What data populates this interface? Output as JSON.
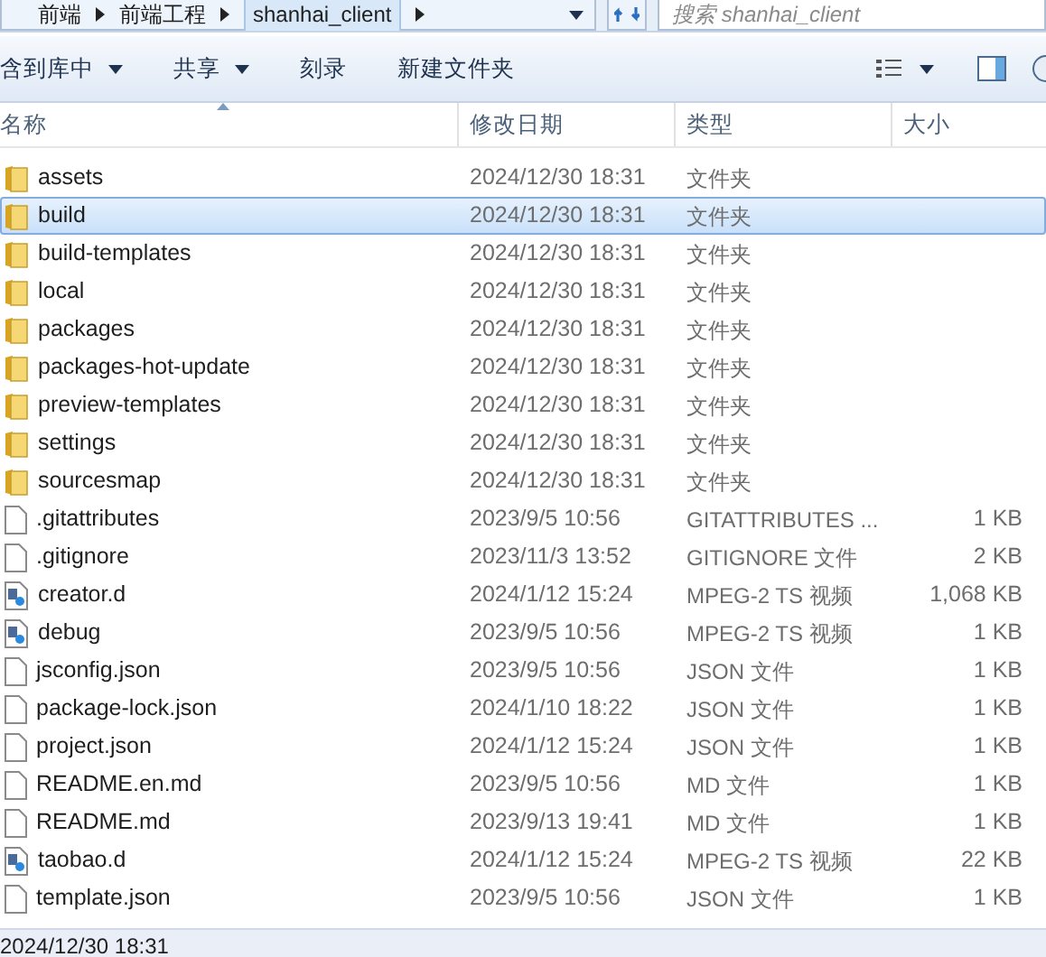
{
  "address_bar": {
    "breadcrumbs": [
      "前端",
      "前端工程",
      "shanhai_client"
    ]
  },
  "search": {
    "placeholder": "搜索 shanhai_client"
  },
  "toolbar": {
    "buttons": [
      {
        "label": "含到库中",
        "dropdown": true
      },
      {
        "label": "共享",
        "dropdown": true
      },
      {
        "label": "刻录",
        "dropdown": false
      },
      {
        "label": "新建文件夹",
        "dropdown": false
      }
    ]
  },
  "table": {
    "columns": [
      "名称",
      "修改日期",
      "类型",
      "大小"
    ],
    "rows": [
      {
        "kind": "folder",
        "name": "assets",
        "date": "2024/12/30 18:31",
        "type": "文件夹",
        "selected": false
      },
      {
        "kind": "folder",
        "name": "build",
        "date": "2024/12/30 18:31",
        "type": "文件夹",
        "selected": true
      },
      {
        "kind": "folder",
        "name": "build-templates",
        "date": "2024/12/30 18:31",
        "type": "文件夹",
        "selected": false
      },
      {
        "kind": "folder",
        "name": "local",
        "date": "2024/12/30 18:31",
        "type": "文件夹",
        "selected": false
      },
      {
        "kind": "folder",
        "name": "packages",
        "date": "2024/12/30 18:31",
        "type": "文件夹",
        "selected": false
      },
      {
        "kind": "folder",
        "name": "packages-hot-update",
        "date": "2024/12/30 18:31",
        "type": "文件夹",
        "selected": false
      },
      {
        "kind": "folder",
        "name": "preview-templates",
        "date": "2024/12/30 18:31",
        "type": "文件夹",
        "selected": false
      },
      {
        "kind": "folder",
        "name": "settings",
        "date": "2024/12/30 18:31",
        "type": "文件夹",
        "selected": false
      },
      {
        "kind": "folder",
        "name": "sourcesmap",
        "date": "2024/12/30 18:31",
        "type": "文件夹",
        "selected": false
      },
      {
        "kind": "file",
        "name": ".gitattributes",
        "date": "2023/9/5 10:56",
        "type": "GITATTRIBUTES ...",
        "size": "1 KB",
        "selected": false
      },
      {
        "kind": "file",
        "name": ".gitignore",
        "date": "2023/11/3 13:52",
        "type": "GITIGNORE 文件",
        "size": "2 KB",
        "selected": false
      },
      {
        "kind": "video",
        "name": "creator.d",
        "date": "2024/1/12 15:24",
        "type": "MPEG-2 TS 视频",
        "size": "1,068 KB",
        "selected": false
      },
      {
        "kind": "video",
        "name": "debug",
        "date": "2023/9/5 10:56",
        "type": "MPEG-2 TS 视频",
        "size": "1 KB",
        "selected": false
      },
      {
        "kind": "file",
        "name": "jsconfig.json",
        "date": "2023/9/5 10:56",
        "type": "JSON 文件",
        "size": "1 KB",
        "selected": false
      },
      {
        "kind": "file",
        "name": "package-lock.json",
        "date": "2024/1/10 18:22",
        "type": "JSON 文件",
        "size": "1 KB",
        "selected": false
      },
      {
        "kind": "file",
        "name": "project.json",
        "date": "2024/1/12 15:24",
        "type": "JSON 文件",
        "size": "1 KB",
        "selected": false
      },
      {
        "kind": "file",
        "name": "README.en.md",
        "date": "2023/9/5 10:56",
        "type": "MD 文件",
        "size": "1 KB",
        "selected": false
      },
      {
        "kind": "file",
        "name": "README.md",
        "date": "2023/9/13 19:41",
        "type": "MD 文件",
        "size": "1 KB",
        "selected": false
      },
      {
        "kind": "video",
        "name": "taobao.d",
        "date": "2024/1/12 15:24",
        "type": "MPEG-2 TS 视频",
        "size": "22 KB",
        "selected": false
      },
      {
        "kind": "file",
        "name": "template.json",
        "date": "2023/9/5 10:56",
        "type": "JSON 文件",
        "size": "1 KB",
        "selected": false
      }
    ]
  },
  "status_bar": {
    "text": "2024/12/30 18:31"
  }
}
